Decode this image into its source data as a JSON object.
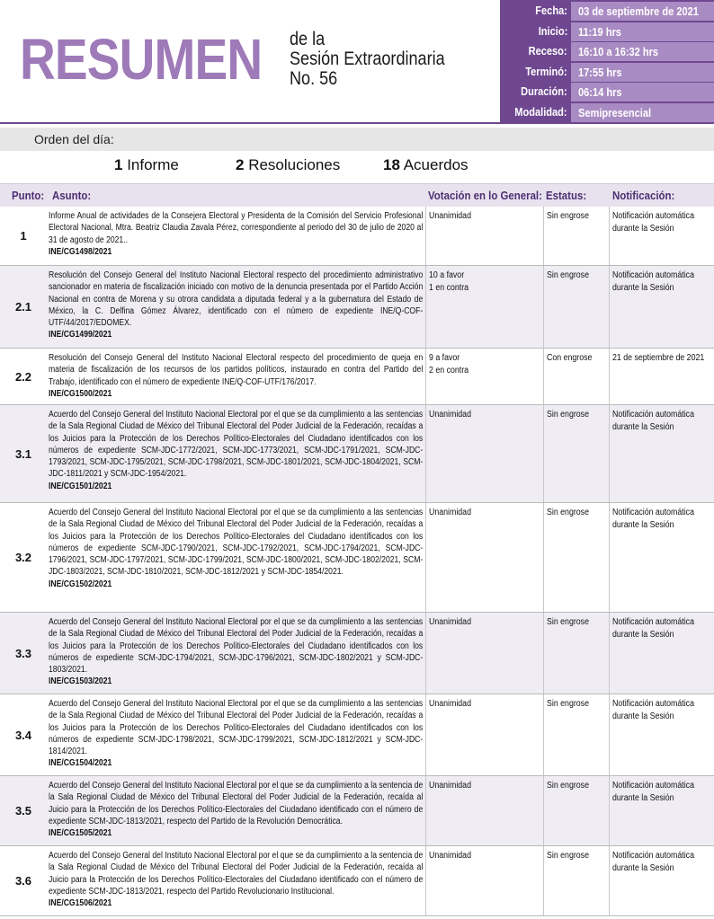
{
  "header": {
    "title_big": "RESUMEN",
    "title_line1": "de la",
    "title_line2": "Sesión Extraordinaria",
    "title_line3": "No. 56",
    "info": [
      {
        "label": "Fecha:",
        "value": "03 de septiembre  de 2021"
      },
      {
        "label": "Inicio:",
        "value": "11:19 hrs"
      },
      {
        "label": "Receso:",
        "value": "16:10 a 16:32 hrs"
      },
      {
        "label": "Terminó:",
        "value": "17:55 hrs"
      },
      {
        "label": "Duración:",
        "value": "06:14 hrs"
      },
      {
        "label": "Modalidad:",
        "value": "Semipresencial"
      }
    ]
  },
  "orden": {
    "label": "Orden del día:",
    "counts": [
      {
        "number": "1",
        "text": " Informe"
      },
      {
        "number": "2",
        "text": " Resoluciones"
      },
      {
        "number": "18",
        "text": " Acuerdos"
      }
    ]
  },
  "table": {
    "headers": {
      "punto": "Punto:",
      "asunto": "Asunto:",
      "votacion": "Votación en lo General:",
      "estatus": "Estatus:",
      "notificacion": "Notificación:"
    },
    "rows": [
      {
        "punto": "1",
        "asunto": "Informe Anual de actividades de la Consejera Electoral y Presidenta de la Comisión del Servicio Profesional Electoral Nacional, Mtra. Beatriz Claudia Zavala Pérez, correspondiente al periodo del 30 de julio de 2020 al 31 de agosto de 2021..",
        "code": "INE/CG1498/2021",
        "votacion": [
          "Unanimidad"
        ],
        "estatus": "Sin engrose",
        "notificacion": [
          "Notificación automática",
          "durante la Sesión"
        ]
      },
      {
        "punto": "2.1",
        "asunto": "Resolución del Consejo General del Instituto Nacional Electoral respecto del procedimiento administrativo sancionador en materia de fiscalización iniciado con motivo de la denuncia presentada por el Partido Acción Nacional en contra de Morena y su otrora candidata a diputada federal y a la gubernatura del Estado de México, la C. Delfina Gómez Álvarez, identificado con el número de expediente INE/Q-COF-UTF/44/2017/EDOMEX.",
        "code": "INE/CG1499/2021",
        "votacion": [
          "10 a favor",
          "1 en contra"
        ],
        "estatus": "Sin engrose",
        "notificacion": [
          "Notificación automática",
          "durante la Sesión"
        ]
      },
      {
        "punto": "2.2",
        "asunto": "Resolución del Consejo General del Instituto Nacional Electoral respecto del procedimiento de queja en materia de fiscalización de los recursos de los partidos políticos, instaurado en contra del Partido del Trabajo, identificado con el número de expediente INE/Q-COF-UTF/176/2017.",
        "code": "INE/CG1500/2021",
        "votacion": [
          "9 a favor",
          "2 en contra"
        ],
        "estatus": "Con engrose",
        "notificacion": [
          "21 de septiembre de 2021"
        ]
      },
      {
        "punto": "3.1",
        "asunto": "Acuerdo del Consejo General del Instituto Nacional Electoral por el que se da cumplimiento a las sentencias de la Sala Regional Ciudad de México del Tribunal Electoral del Poder Judicial de la Federación, recaídas a los Juicios para la Protección de los Derechos Político-Electorales del Ciudadano identificados con los números de expediente SCM-JDC-1772/2021, SCM-JDC-1773/2021, SCM-JDC-1791/2021, SCM-JDC-1793/2021, SCM-JDC-1795/2021, SCM-JDC-1798/2021, SCM-JDC-1801/2021, SCM-JDC-1804/2021, SCM-JDC-1811/2021 y SCM-JDC-1954/2021.",
        "code": "INE/CG1501/2021",
        "votacion": [
          "Unanimidad"
        ],
        "estatus": "Sin engrose",
        "notificacion": [
          "Notificación automática",
          "durante la Sesión"
        ]
      },
      {
        "punto": "3.2",
        "asunto": "Acuerdo del Consejo General del Instituto Nacional Electoral por el que se da cumplimiento a las sentencias de la Sala Regional Ciudad de México del Tribunal Electoral del Poder Judicial de la Federación, recaídas a los Juicios para la Protección de los Derechos Político-Electorales del Ciudadano identificados con los números de expediente SCM-JDC-1790/2021, SCM-JDC-1792/2021, SCM-JDC-1794/2021, SCM-JDC-1796/2021, SCM-JDC-1797/2021, SCM-JDC-1799/2021, SCM-JDC-1800/2021, SCM-JDC-1802/2021, SCM-JDC-1803/2021, SCM-JDC-1810/2021, SCM-JDC-1812/2021 y SCM-JDC-1854/2021.",
        "code": "INE/CG1502/2021",
        "votacion": [
          "Unanimidad"
        ],
        "estatus": "Sin engrose",
        "notificacion": [
          "Notificación automática",
          "durante la Sesión"
        ]
      },
      {
        "punto": "3.3",
        "asunto": "Acuerdo del Consejo General del Instituto Nacional Electoral por el que se da cumplimiento a las sentencias de la Sala Regional Ciudad de México del Tribunal Electoral del Poder Judicial de la Federación, recaídas a los Juicios para la Protección de los Derechos Político-Electorales del Ciudadano identificados con los números de expediente SCM-JDC-1794/2021, SCM-JDC-1796/2021, SCM-JDC-1802/2021 y SCM-JDC-1803/2021.",
        "code": "INE/CG1503/2021",
        "votacion": [
          "Unanimidad"
        ],
        "estatus": "Sin engrose",
        "notificacion": [
          "Notificación automática",
          "durante la Sesión"
        ]
      },
      {
        "punto": "3.4",
        "asunto": "Acuerdo del Consejo General del Instituto Nacional Electoral por el que se da cumplimiento a las sentencias de la Sala Regional Ciudad de México del Tribunal Electoral del Poder Judicial de la Federación, recaídas a los Juicios para la Protección de los Derechos Político-Electorales del Ciudadano identificados con los números de expediente SCM-JDC-1798/2021, SCM-JDC-1799/2021, SCM-JDC-1812/2021 y SCM-JDC-1814/2021.",
        "code": "INE/CG1504/2021",
        "votacion": [
          "Unanimidad"
        ],
        "estatus": "Sin engrose",
        "notificacion": [
          "Notificación automática",
          "durante la Sesión"
        ]
      },
      {
        "punto": "3.5",
        "asunto": "Acuerdo del Consejo General del Instituto Nacional Electoral por el que se da cumplimiento a la sentencia de la Sala Regional Ciudad de México del Tribunal Electoral del Poder Judicial de la Federación, recaída al Juicio para la Protección de los Derechos Político-Electorales del Ciudadano identificado con el número de expediente SCM-JDC-1813/2021, respecto del Partido de la Revolución Democrática.",
        "code": "INE/CG1505/2021",
        "votacion": [
          "Unanimidad"
        ],
        "estatus": "Sin engrose",
        "notificacion": [
          "Notificación automática",
          "durante la Sesión"
        ]
      },
      {
        "punto": "3.6",
        "asunto": "Acuerdo del Consejo General del Instituto Nacional Electoral por el que se da cumplimiento a la sentencia de la Sala Regional Ciudad de México del Tribunal Electoral del Poder Judicial de la Federación, recaída al Juicio para la Protección de los Derechos Político-Electorales del Ciudadano identificado con el número de expediente SCM-JDC-1813/2021, respecto del Partido Revolucionario Institucional.",
        "code": "INE/CG1506/2021",
        "votacion": [
          "Unanimidad"
        ],
        "estatus": "Sin engrose",
        "notificacion": [
          "Notificación automática",
          "durante la Sesión"
        ]
      }
    ]
  },
  "colors": {
    "accent_dark": "#6f4790",
    "accent_light": "#a98bc3",
    "title": "#9e7ab8"
  }
}
